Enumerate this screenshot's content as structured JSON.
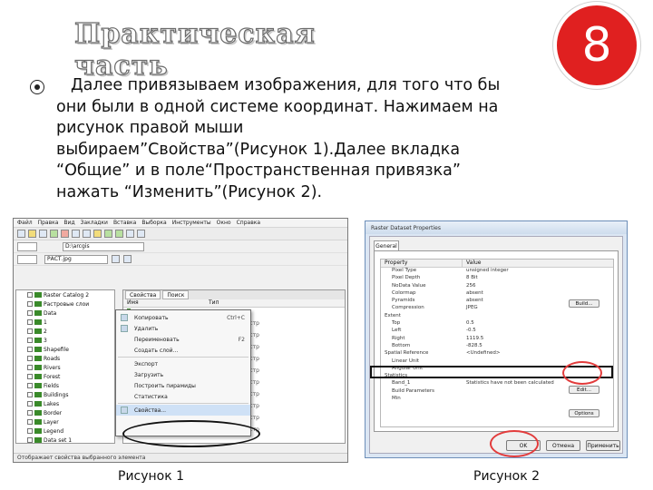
{
  "slide": {
    "title": "Практическая часть",
    "number": "8",
    "body_lines": [
      "Далее привязываем изображения, для того что бы",
      "они были в одной системе координат. Нажимаем на",
      "рисунок правой мыши",
      "выбираем”Свойства”(Рисунок 1).Далее вкладка",
      "“Общие” и в поле“Пространственная привязка”",
      "нажать “Изменить”(Рисунок 2)."
    ],
    "captions": {
      "figure1": "Рисунок 1",
      "figure2": "Рисунок 2"
    }
  },
  "colors": {
    "badge": "#e02020",
    "highlight_ellipse": "#111111",
    "red_marker": "#e23c3c"
  },
  "figure1": {
    "menu": [
      "Файл",
      "Правка",
      "Вид",
      "Закладки",
      "Вставка",
      "Выборка",
      "Инструменты",
      "Окно",
      "Справка"
    ],
    "combo1": "D:\\arcgis",
    "combo2": "РАСТ.jpg",
    "tabs": [
      "Свойства",
      "Поиск"
    ],
    "columns": [
      "Имя",
      "Тип"
    ],
    "tree": [
      "Raster Catalog 2",
      "Растровые слои",
      "Data",
      "1",
      "2",
      "3",
      "Shapefile",
      "Roads",
      "Rivers",
      "Forest",
      "Fields",
      "Buildings",
      "Lakes",
      "Border",
      "Layer",
      "Legend",
      "Data set 1"
    ],
    "types": [
      "",
      "Растр",
      "Растр",
      "Растр",
      "Растр",
      "Растр",
      "Растр",
      "Растр",
      "Растр",
      "Растр",
      "Растр"
    ],
    "context_menu": [
      {
        "label": "Копировать",
        "shortcut": "Ctrl+C"
      },
      {
        "label": "Удалить",
        "shortcut": ""
      },
      {
        "label": "Переименовать",
        "shortcut": "F2"
      },
      {
        "label": "Создать слой...",
        "shortcut": ""
      },
      {
        "label": "Экспорт",
        "shortcut": ""
      },
      {
        "label": "Загрузить",
        "shortcut": ""
      },
      {
        "label": "Построить пирамиды",
        "shortcut": ""
      },
      {
        "label": "Статистика",
        "shortcut": ""
      },
      {
        "label": "Свойства...",
        "shortcut": ""
      }
    ],
    "status": "Отображает свойства выбранного элемента"
  },
  "figure2": {
    "window_title": "Raster Dataset Properties",
    "tab": "General",
    "columns": [
      "Property",
      "Value"
    ],
    "rows": [
      {
        "k": "Pixel Type",
        "v": "unsigned integer",
        "group": false
      },
      {
        "k": "Pixel Depth",
        "v": "8 Bit",
        "group": false
      },
      {
        "k": "NoData Value",
        "v": "256",
        "group": false
      },
      {
        "k": "Colormap",
        "v": "absent",
        "group": false
      },
      {
        "k": "Pyramids",
        "v": "absent",
        "group": false
      },
      {
        "k": "Compression",
        "v": "JPEG",
        "group": false
      },
      {
        "k": "Extent",
        "v": "",
        "group": true
      },
      {
        "k": "Top",
        "v": "0.5",
        "group": false
      },
      {
        "k": "Left",
        "v": "-0.5",
        "group": false
      },
      {
        "k": "Right",
        "v": "1119.5",
        "group": false
      },
      {
        "k": "Bottom",
        "v": "-828.5",
        "group": false
      },
      {
        "k": "Spatial Reference",
        "v": "<Undefined>",
        "group": true
      },
      {
        "k": "Linear Unit",
        "v": "",
        "group": false
      },
      {
        "k": "Angular Unit",
        "v": "",
        "group": false
      },
      {
        "k": "Statistics",
        "v": "",
        "group": true
      },
      {
        "k": "Band_1",
        "v": "Statistics have not been calculated",
        "group": false
      },
      {
        "k": "Build Parameters",
        "v": "",
        "group": false
      },
      {
        "k": "Min",
        "v": "",
        "group": false
      }
    ],
    "buttons": {
      "build": "Build...",
      "edit": "Edit...",
      "options": "Options",
      "ok": "OK",
      "cancel": "Отмена",
      "apply": "Применить"
    }
  }
}
